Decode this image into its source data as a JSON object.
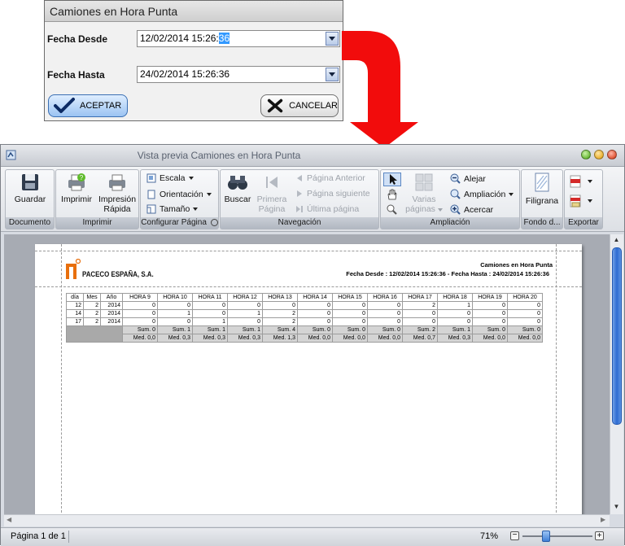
{
  "dialog": {
    "title": "Camiones en Hora Punta",
    "desde_label": "Fecha Desde",
    "desde_value_plain": "12/02/2014 15:26:",
    "desde_value_selected": "36",
    "hasta_label": "Fecha Hasta",
    "hasta_value": "24/02/2014 15:26:36",
    "ok_label": "ACEPTAR",
    "cancel_label": "CANCELAR"
  },
  "window": {
    "title": "Vista previa Camiones en Hora Punta"
  },
  "ribbon": {
    "groups": {
      "documento": "Documento",
      "imprimir": "Imprimir",
      "configurar": "Configurar Página",
      "navegacion": "Navegación",
      "ampliacion": "Ampliación",
      "fondo": "Fondo d...",
      "exportar": "Exportar"
    },
    "guardar": "Guardar",
    "imprimir": "Imprimir",
    "impresion_rapida_1": "Impresión",
    "impresion_rapida_2": "Rápida",
    "escala": "Escala",
    "orientacion": "Orientación",
    "tamano": "Tamaño",
    "buscar": "Buscar",
    "primera_1": "Primera",
    "primera_2": "Página",
    "pagina_anterior": "Página Anterior",
    "pagina_siguiente": "Página siguiente",
    "ultima_pagina": "Última página",
    "varias_1": "Varias",
    "varias_2": "páginas",
    "alejar": "Alejar",
    "ampliacion": "Ampliación",
    "acercar": "Acercar",
    "filigrana": "Filigrana"
  },
  "report": {
    "company": "PACECO ESPAÑA, S.A.",
    "title": "Camiones en Hora Punta",
    "subtitle": "Fecha Desde : 12/02/2014 15:26:36 - Fecha Hasta : 24/02/2014 15:26:36",
    "columns": [
      "día",
      "Mes",
      "Año",
      "HORA 9",
      "HORA 10",
      "HORA 11",
      "HORA 12",
      "HORA 13",
      "HORA 14",
      "HORA 15",
      "HORA 16",
      "HORA 17",
      "HORA 18",
      "HORA 19",
      "HORA 20"
    ],
    "rows": [
      [
        "12",
        "2",
        "2014",
        "0",
        "0",
        "0",
        "0",
        "0",
        "0",
        "0",
        "0",
        "2",
        "1",
        "0",
        "0"
      ],
      [
        "14",
        "2",
        "2014",
        "0",
        "1",
        "0",
        "1",
        "2",
        "0",
        "0",
        "0",
        "0",
        "0",
        "0",
        "0"
      ],
      [
        "17",
        "2",
        "2014",
        "0",
        "0",
        "1",
        "0",
        "2",
        "0",
        "0",
        "0",
        "0",
        "0",
        "0",
        "0"
      ]
    ],
    "sums": [
      "Sum. 0",
      "Sum. 1",
      "Sum. 1",
      "Sum. 1",
      "Sum. 4",
      "Sum. 0",
      "Sum. 0",
      "Sum. 0",
      "Sum. 2",
      "Sum. 1",
      "Sum. 0",
      "Sum. 0"
    ],
    "means": [
      "Med. 0,0",
      "Med. 0,3",
      "Med. 0,3",
      "Med. 0,3",
      "Med. 1,3",
      "Med. 0,0",
      "Med. 0,0",
      "Med. 0,0",
      "Med. 0,7",
      "Med. 0,3",
      "Med. 0,0",
      "Med. 0,0"
    ]
  },
  "status": {
    "page": "Página 1 de 1",
    "zoom": "71%"
  }
}
